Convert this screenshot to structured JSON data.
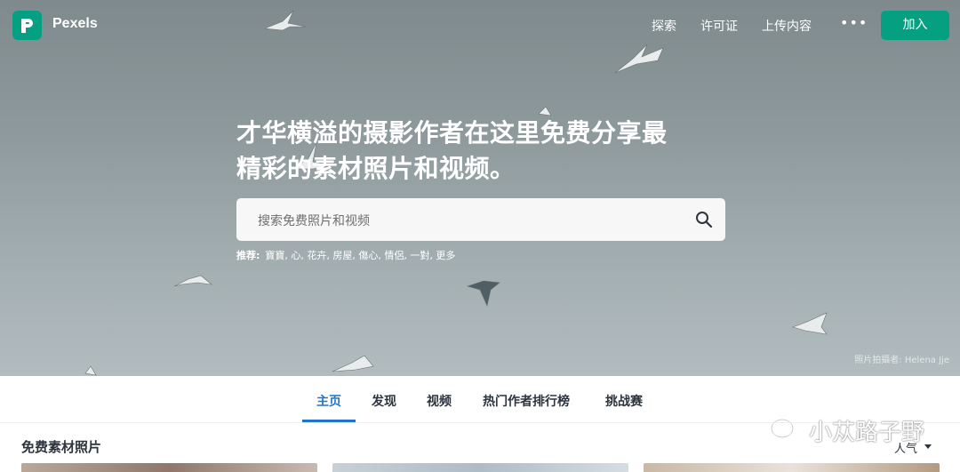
{
  "header": {
    "brand": "Pexels",
    "nav": {
      "explore": "探索",
      "license": "许可证",
      "upload": "上传内容",
      "more": "•••"
    },
    "join_label": "加入"
  },
  "hero": {
    "headline_line1": "才华横溢的摄影作者在这里免费分享最",
    "headline_line2": "精彩的素材照片和视频。",
    "search": {
      "placeholder": "搜索免费照片和视频"
    },
    "suggest_label": "推荐:",
    "suggestions": "寶寶, 心, 花卉, 房屋, 傷心, 情侶, 一對, 更多",
    "credit": "照片拍攝者: Helena Jje"
  },
  "tabs": {
    "home": "主页",
    "discover": "发现",
    "video": "视频",
    "leaderboard": "热门作者排行榜",
    "challenge": "挑战赛"
  },
  "main": {
    "section_title": "免费素材照片",
    "sort_label": "人气"
  },
  "watermark": "小苁路子野",
  "colors": {
    "brand_green": "#05a081",
    "active_tab": "#1f75cc"
  }
}
